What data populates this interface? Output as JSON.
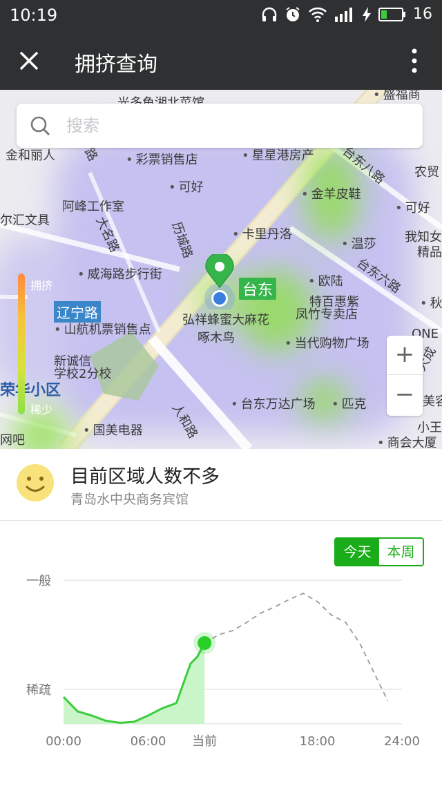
{
  "status_bar": {
    "time": "10:19",
    "battery": "16"
  },
  "title_bar": {
    "title": "拥挤查询"
  },
  "search": {
    "placeholder": "搜索"
  },
  "map": {
    "labels": {
      "l1": "金和丽人",
      "l2": "彩票销售店",
      "l3": "星星港房产",
      "l4": "可好",
      "l5": "金羊皮鞋",
      "l6": "农贸",
      "l7": "阿峰工作室",
      "l8": "可好",
      "l9": "尔汇文具",
      "l10": "卡里丹洛",
      "l11": "温莎",
      "l12": "我知女",
      "l13": "精品",
      "l14": "威海路步行街",
      "l15": "欧陆",
      "l16": "特百惠紫",
      "l17": "秋",
      "l18": "山航机票销售点",
      "l19": "弘祥蜂蜜大麻花",
      "l20": "凤竹专卖店",
      "l21": "啄木鸟",
      "l22": "当代购物广场",
      "l23": "ONE",
      "l24": "新诚信",
      "l25": "学校2分校",
      "l26": "台东万达广场",
      "l27": "匹克",
      "l28": "美容",
      "l29": "国美电器",
      "l30": "小王",
      "l31": "网吧",
      "l32": "商会大厦",
      "l33": "台东八路",
      "l34": "大名路",
      "l35": "历城路",
      "l36": "台东六路",
      "l37": "人和路",
      "l38": "大成",
      "l39": "路",
      "l40": "盛福商",
      "l41": "光多鱼湘北菜馆"
    },
    "road_tag": "辽宁路",
    "district": "荣华小区",
    "place_tag": "台东",
    "legend": {
      "high": "拥挤",
      "low": "稀少"
    },
    "zoom_in": "+",
    "zoom_out": "−",
    "colors": {
      "heat_green": "#8ee04a",
      "heat_purple": "#b9b4f0",
      "road": "#f2e8c6"
    }
  },
  "crowd_status": {
    "title": "目前区域人数不多",
    "location": "青岛水中央商务宾馆",
    "icon": "smiley-icon"
  },
  "period_toggle": {
    "today": "今天",
    "week": "本周",
    "active": "today"
  },
  "chart_data": {
    "type": "area",
    "x_ticks": [
      "00:00",
      "06:00",
      "当前",
      "18:00",
      "24:00"
    ],
    "y_ticks": [
      "一般",
      "稀疏"
    ],
    "xlim": [
      0,
      24
    ],
    "current_hour": 10,
    "actual": {
      "x": [
        0,
        1,
        2,
        3,
        4,
        5,
        6,
        7,
        8,
        9,
        9.5,
        10
      ],
      "y": [
        0.26,
        0.12,
        0.08,
        0.03,
        0.01,
        0.02,
        0.08,
        0.15,
        0.2,
        0.58,
        0.65,
        0.78
      ]
    },
    "forecast": {
      "x": [
        10,
        11,
        12,
        13,
        14,
        15,
        16,
        17,
        18,
        19,
        20,
        21,
        22,
        23
      ],
      "y": [
        0.78,
        0.86,
        0.9,
        0.98,
        1.07,
        1.13,
        1.2,
        1.26,
        1.18,
        1.05,
        0.98,
        0.78,
        0.5,
        0.22
      ]
    },
    "colors": {
      "line": "#3ccc3c",
      "fill": "#c9f5c9",
      "forecast": "#999999",
      "dot": "#28d028"
    }
  }
}
